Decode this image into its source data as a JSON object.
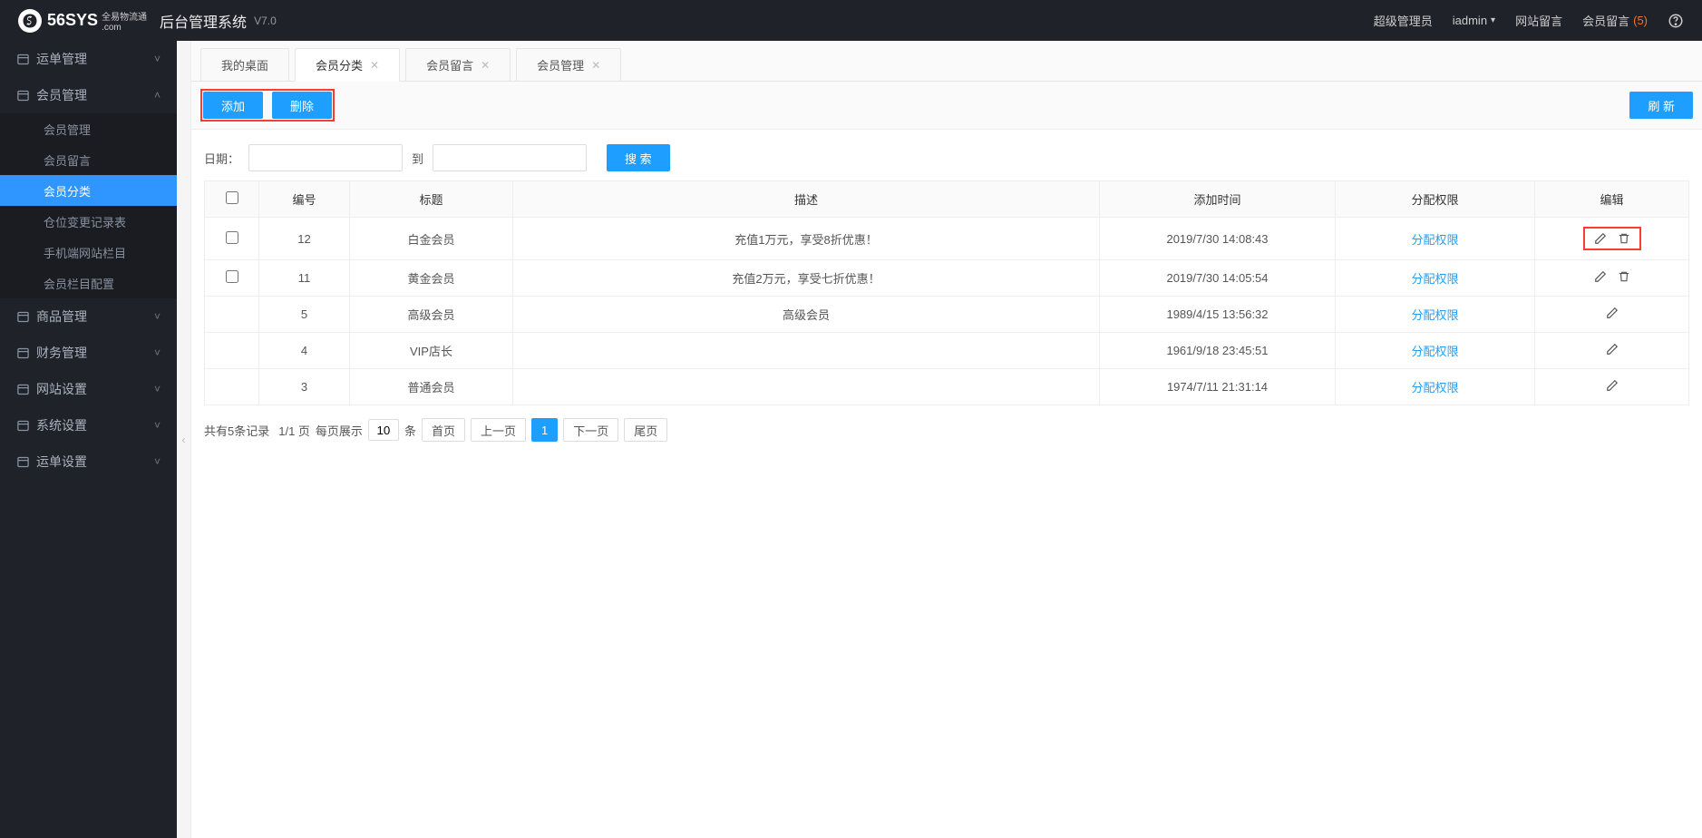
{
  "header": {
    "logo_main": "56SYS",
    "logo_sub": ".com",
    "logo_tag": "全易物流通",
    "sys_title": "后台管理系统",
    "version": "V7.0",
    "role": "超级管理员",
    "user": "iadmin",
    "site_msg": "网站留言",
    "member_msg": "会员留言",
    "member_msg_count": "(5)"
  },
  "sidebar": {
    "items": [
      {
        "label": "运单管理",
        "expanded": false
      },
      {
        "label": "会员管理",
        "expanded": true,
        "children": [
          {
            "label": "会员管理"
          },
          {
            "label": "会员留言"
          },
          {
            "label": "会员分类",
            "active": true
          },
          {
            "label": "仓位变更记录表"
          },
          {
            "label": "手机端网站栏目"
          },
          {
            "label": "会员栏目配置"
          }
        ]
      },
      {
        "label": "商品管理",
        "expanded": false
      },
      {
        "label": "财务管理",
        "expanded": false
      },
      {
        "label": "网站设置",
        "expanded": false
      },
      {
        "label": "系统设置",
        "expanded": false
      },
      {
        "label": "运单设置",
        "expanded": false
      }
    ]
  },
  "tabs": [
    {
      "label": "我的桌面",
      "closable": false
    },
    {
      "label": "会员分类",
      "closable": true,
      "active": true
    },
    {
      "label": "会员留言",
      "closable": true
    },
    {
      "label": "会员管理",
      "closable": true
    }
  ],
  "toolbar": {
    "add": "添加",
    "delete": "删除",
    "refresh": "刷 新"
  },
  "filter": {
    "date_label": "日期：",
    "to": "到",
    "search": "搜 索"
  },
  "table": {
    "headers": {
      "id": "编号",
      "title": "标题",
      "desc": "描述",
      "time": "添加时间",
      "perm": "分配权限",
      "edit": "编辑"
    },
    "perm_link": "分配权限",
    "rows": [
      {
        "chk": true,
        "id": "12",
        "title": "白金会员",
        "desc": "充值1万元，享受8折优惠！",
        "time": "2019/7/30 14:08:43",
        "deletable": true,
        "highlight": true
      },
      {
        "chk": true,
        "id": "11",
        "title": "黄金会员",
        "desc": "充值2万元，享受七折优惠！",
        "time": "2019/7/30 14:05:54",
        "deletable": true
      },
      {
        "chk": false,
        "id": "5",
        "title": "高级会员",
        "desc": "高级会员",
        "time": "1989/4/15 13:56:32",
        "deletable": false
      },
      {
        "chk": false,
        "id": "4",
        "title": "VIP店长",
        "desc": "",
        "time": "1961/9/18 23:45:51",
        "deletable": false
      },
      {
        "chk": false,
        "id": "3",
        "title": "普通会员",
        "desc": "",
        "time": "1974/7/11 21:31:14",
        "deletable": false
      }
    ]
  },
  "pager": {
    "total": "共有5条记录",
    "page": "1/1 页",
    "per_page_label": "每页展示",
    "per_page_value": "10",
    "unit": "条",
    "first": "首页",
    "prev": "上一页",
    "current": "1",
    "next": "下一页",
    "last": "尾页"
  }
}
